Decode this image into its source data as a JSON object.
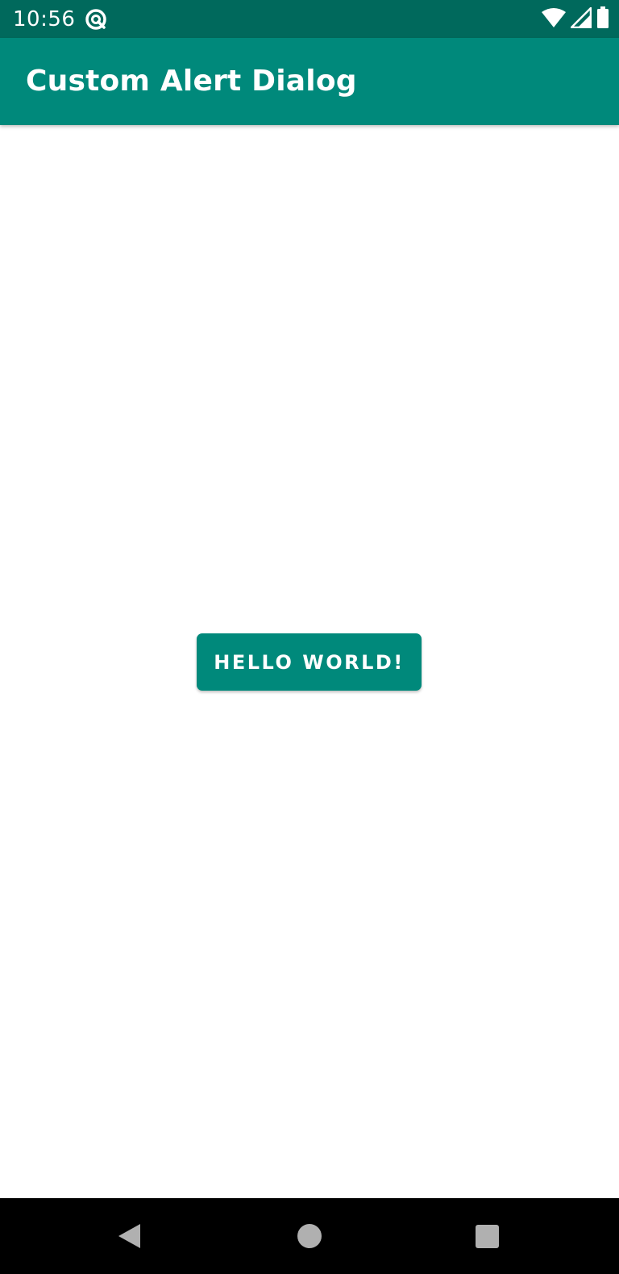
{
  "status_bar": {
    "time": "10:56",
    "icons": [
      "notification-icon",
      "wifi-icon",
      "cell-signal-icon",
      "battery-icon"
    ]
  },
  "app_bar": {
    "title": "Custom Alert Dialog"
  },
  "main": {
    "button_label": "Hello World!"
  },
  "nav_bar": {
    "icons": [
      "back-icon",
      "home-icon",
      "recents-icon"
    ]
  },
  "colors": {
    "status_bar": "#00695c",
    "primary": "#00897b",
    "background": "#ffffff",
    "nav_bar": "#000000"
  }
}
